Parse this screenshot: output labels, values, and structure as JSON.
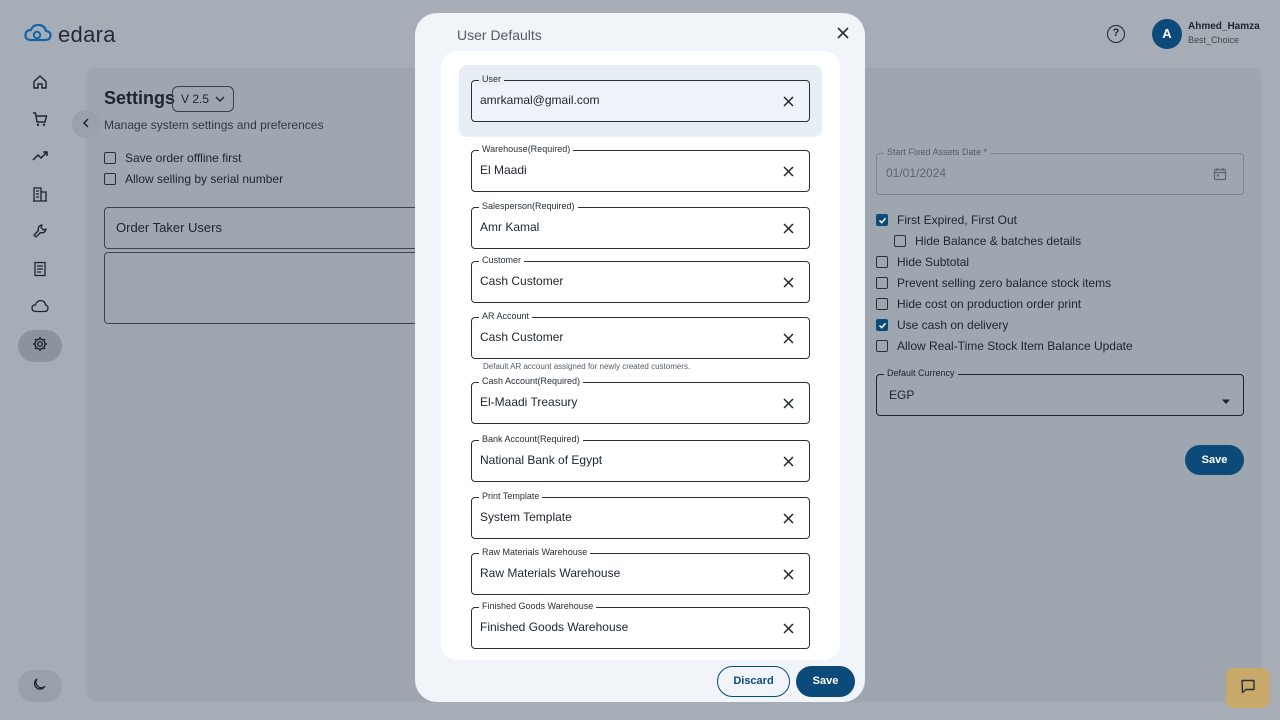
{
  "app": {
    "logo_text": "edara"
  },
  "header": {
    "help_icon": "question-circle-icon",
    "avatar_letter": "A",
    "user_name": "Ahmed_Hamza",
    "company": "Best_Choice"
  },
  "sidebar": {
    "items": [
      {
        "name": "home",
        "icon": "home-icon"
      },
      {
        "name": "sales",
        "icon": "cart-icon"
      },
      {
        "name": "reports",
        "icon": "trending-icon"
      },
      {
        "name": "company",
        "icon": "building-icon"
      },
      {
        "name": "tools",
        "icon": "wrench-icon"
      },
      {
        "name": "receipts",
        "icon": "receipt-icon"
      },
      {
        "name": "cloud",
        "icon": "cloud-icon"
      },
      {
        "name": "settings",
        "icon": "gear-icon",
        "active": true
      }
    ],
    "theme_icon": "moon-icon"
  },
  "settings": {
    "title": "Settings",
    "version": "V 2.5",
    "subtitle": "Manage system settings and preferences",
    "left_checks": [
      {
        "label": "Save order offline first",
        "checked": false
      },
      {
        "label": "Allow selling by serial number",
        "checked": false
      }
    ],
    "order_taker_label": "Order Taker Users",
    "fixed_assets": {
      "label": "Start Fixed Assets Date *",
      "value": "01/01/2024"
    },
    "right_checks": [
      {
        "label": "First Expired, First Out",
        "checked": true
      },
      {
        "label": "Hide Balance & batches details",
        "checked": false
      },
      {
        "label": "Hide Subtotal",
        "checked": false
      },
      {
        "label": "Prevent selling zero balance stock items",
        "checked": false
      },
      {
        "label": "Hide cost on production order print",
        "checked": false
      },
      {
        "label": "Use cash on delivery",
        "checked": true
      },
      {
        "label": "Allow Real-Time Stock Item Balance Update",
        "checked": false
      }
    ],
    "currency": {
      "label": "Default Currency",
      "value": "EGP"
    },
    "save_label": "Save"
  },
  "dialog": {
    "title": "User Defaults",
    "fields": [
      {
        "label": "User",
        "value": "amrkamal@gmail.com"
      },
      {
        "label": "Warehouse(Required)",
        "value": "El Maadi"
      },
      {
        "label": "Salesperson(Required)",
        "value": "Amr Kamal"
      },
      {
        "label": "Customer",
        "value": "Cash Customer"
      },
      {
        "label": "AR Account",
        "value": "Cash Customer",
        "helper": "Default AR account assigned for newly created customers."
      },
      {
        "label": "Cash Account(Required)",
        "value": "El-Maadi Treasury"
      },
      {
        "label": "Bank Account(Required)",
        "value": "National Bank of Egypt"
      },
      {
        "label": "Print Template",
        "value": "System Template"
      },
      {
        "label": "Raw Materials Warehouse",
        "value": "Raw Materials Warehouse"
      },
      {
        "label": "Finished Goods Warehouse",
        "value": "Finished Goods Warehouse"
      }
    ],
    "discard_label": "Discard",
    "save_label": "Save"
  },
  "colors": {
    "primary": "#0c4a7a",
    "overlay_bg": "#a6adb6",
    "chat_button": "#c8a96b"
  }
}
